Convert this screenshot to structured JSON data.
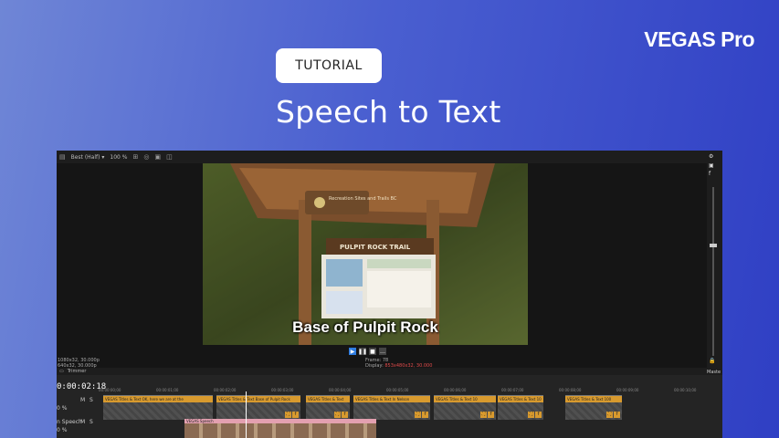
{
  "brand": "VEGAS Pro",
  "tag": "TUTORIAL",
  "title": "Speech to Text",
  "app": {
    "preview_toolbar": {
      "quality": "Best (Half) ▾",
      "zoom": "100 %"
    },
    "preview": {
      "sign_title": "PULPIT ROCK TRAIL",
      "sign_top": "Recreation Sites and Trails BC",
      "caption": "Base of Pulpit Rock"
    },
    "info_left": [
      "1080x32, 30.000p",
      "640x32, 30.000p"
    ],
    "info_mid": {
      "frame_label": "Frame:",
      "frame_value": "78",
      "display_label": "Display:",
      "display_value": "853x480x32, 30.000"
    },
    "trimmer_label": "Trimmer",
    "master_label": "Maste",
    "timeline": {
      "timecode": "0:00:02:18",
      "ruler": [
        "00:00:00;00",
        "00:00:01;00",
        "00:00:02;00",
        "00:00:03;00",
        "00:00:04;00",
        "00:00:05;00",
        "00:00:06;00",
        "00:00:07;00",
        "00:00:08;00",
        "00:00:09;00",
        "00:00:10;00"
      ],
      "track1": {
        "m": "M",
        "s": "S",
        "level": "0 %"
      },
      "track2": {
        "name": "n Speech",
        "m": "M",
        "s": "S",
        "level": "0 %"
      },
      "clips": [
        "VEGAS Titles & Text OK, here we are at the",
        "VEGAS Titles & Text Base of Pulpit Rock",
        "VEGAS Titles & Text",
        "VEGAS Titles & Text In Nelson",
        "VEGAS Titles & Text 10",
        "VEGAS Titles & Text 10",
        "VEGAS Titles & Text 100"
      ],
      "audio_clip": "VEGAS Speech"
    }
  }
}
